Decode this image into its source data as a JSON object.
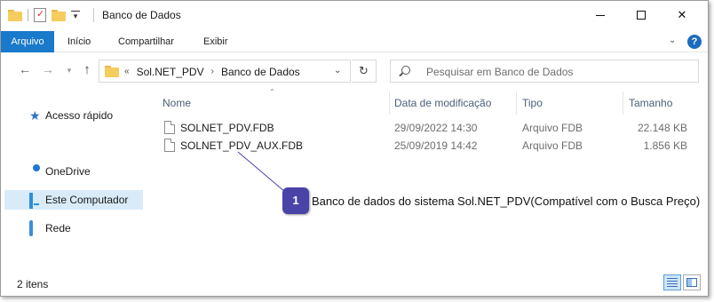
{
  "window": {
    "title": "Banco de Dados",
    "controls": {
      "minimize": "",
      "maximize": "",
      "close": "✕"
    }
  },
  "ribbon": {
    "tabs": [
      {
        "label": "Arquivo",
        "active": true
      },
      {
        "label": "Início"
      },
      {
        "label": "Compartilhar"
      },
      {
        "label": "Exibir"
      }
    ],
    "help_label": "?",
    "expand_glyph": "⌄"
  },
  "address": {
    "breadcrumbs": [
      "Sol.NET_PDV",
      "Banco de Dados"
    ],
    "overflow_glyph": "«",
    "sep_glyph": "›"
  },
  "search": {
    "placeholder": "Pesquisar em Banco de Dados"
  },
  "sidebar": {
    "items": [
      {
        "label": "Acesso rápido",
        "icon": "star-icon"
      },
      {
        "label": "OneDrive",
        "icon": "cloud-icon"
      },
      {
        "label": "Este Computador",
        "icon": "computer-icon",
        "selected": true
      },
      {
        "label": "Rede",
        "icon": "network-icon"
      }
    ]
  },
  "columns": [
    "Nome",
    "Data de modificação",
    "Tipo",
    "Tamanho"
  ],
  "files": [
    {
      "name": "SOLNET_PDV.FDB",
      "modified": "29/09/2022 14:30",
      "type": "Arquivo FDB",
      "size": "22.148 KB"
    },
    {
      "name": "SOLNET_PDV_AUX.FDB",
      "modified": "25/09/2019 14:42",
      "type": "Arquivo FDB",
      "size": "1.856 KB"
    }
  ],
  "callout": {
    "number": "1",
    "text": "Banco de dados do sistema Sol.NET_PDV(Compatível com o Busca Preço)",
    "color": "#4a44a8"
  },
  "status": {
    "count": "2 itens"
  },
  "colors": {
    "accent": "#1979ca",
    "selection": "#d9ebf9"
  }
}
